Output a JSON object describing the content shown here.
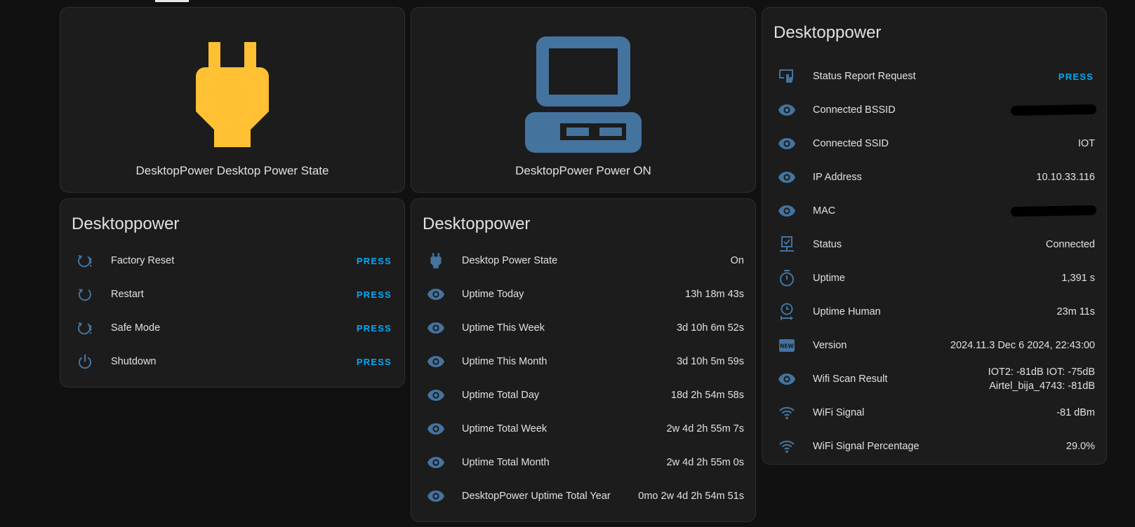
{
  "colors": {
    "background": "#111111",
    "card": "#1c1c1c",
    "accent": "#03a9f4",
    "icon": "#44739e",
    "plug_on": "#ffc033"
  },
  "tiles": {
    "power_state": {
      "name": "DesktopPower Desktop Power State",
      "icon": "power-plug-icon"
    },
    "power_on": {
      "name": "DesktopPower Power ON",
      "icon": "desktop-computer-icon"
    }
  },
  "buttons_card": {
    "title": "Desktoppower",
    "rows": [
      {
        "icon": "restart-alert-icon",
        "label": "Factory Reset",
        "action": "PRESS"
      },
      {
        "icon": "restart-icon",
        "label": "Restart",
        "action": "PRESS"
      },
      {
        "icon": "restart-alert-icon",
        "label": "Safe Mode",
        "action": "PRESS"
      },
      {
        "icon": "power-icon",
        "label": "Shutdown",
        "action": "PRESS"
      }
    ]
  },
  "uptime_card": {
    "title": "Desktoppower",
    "rows": [
      {
        "icon": "power-plug-icon",
        "label": "Desktop Power State",
        "value": "On"
      },
      {
        "icon": "eye-icon",
        "label": "Uptime Today",
        "value": "13h 18m 43s"
      },
      {
        "icon": "eye-icon",
        "label": "Uptime This Week",
        "value": "3d 10h 6m 52s"
      },
      {
        "icon": "eye-icon",
        "label": "Uptime This Month",
        "value": "3d 10h 5m 59s"
      },
      {
        "icon": "eye-icon",
        "label": "Uptime Total Day",
        "value": "18d 2h 54m 58s"
      },
      {
        "icon": "eye-icon",
        "label": "Uptime Total Week",
        "value": "2w 4d 2h 55m 7s"
      },
      {
        "icon": "eye-icon",
        "label": "Uptime Total Month",
        "value": "2w 4d 2h 55m 0s"
      },
      {
        "icon": "eye-icon",
        "label": "DesktopPower Uptime Total Year",
        "value": "0mo 2w 4d 2h 54m 51s"
      }
    ]
  },
  "diag_card": {
    "title": "Desktoppower",
    "rows": [
      {
        "icon": "gesture-tap-icon",
        "label": "Status Report Request",
        "action": "PRESS"
      },
      {
        "icon": "eye-icon",
        "label": "Connected BSSID",
        "value": "",
        "redacted": true
      },
      {
        "icon": "eye-icon",
        "label": "Connected SSID",
        "value": "IOT"
      },
      {
        "icon": "eye-icon",
        "label": "IP Address",
        "value": "10.10.33.116"
      },
      {
        "icon": "eye-icon",
        "label": "MAC",
        "value": "",
        "redacted": true
      },
      {
        "icon": "lan-check-icon",
        "label": "Status",
        "value": "Connected"
      },
      {
        "icon": "timer-icon",
        "label": "Uptime",
        "value": "1,391 s"
      },
      {
        "icon": "clock-start-icon",
        "label": "Uptime Human",
        "value": "23m 11s"
      },
      {
        "icon": "new-box-icon",
        "label": "Version",
        "value": "2024.11.3 Dec 6 2024, 22:43:00"
      },
      {
        "icon": "eye-icon",
        "label": "Wifi Scan Result",
        "value": "IOT2: -81dB IOT: -75dB Airtel_bija_4743: -81dB",
        "wrap": true
      },
      {
        "icon": "wifi-icon",
        "label": "WiFi Signal",
        "value": "-81 dBm"
      },
      {
        "icon": "wifi-icon",
        "label": "WiFi Signal Percentage",
        "value": "29.0%"
      }
    ]
  }
}
